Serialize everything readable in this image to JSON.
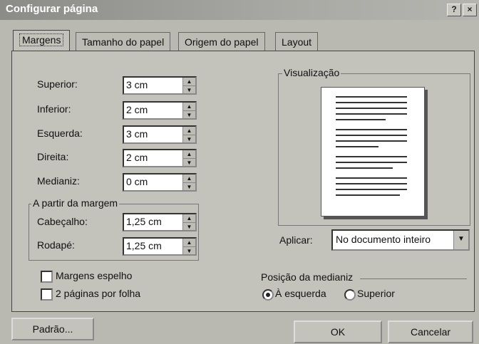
{
  "window": {
    "title": "Configurar página",
    "help_btn": "?",
    "close_btn": "×"
  },
  "tabs": [
    {
      "label": "Margens",
      "active": true
    },
    {
      "label": "Tamanho do papel",
      "active": false
    },
    {
      "label": "Origem do papel",
      "active": false
    },
    {
      "label": "Layout",
      "active": false
    }
  ],
  "margins": {
    "top_label": "Superior:",
    "top_value": "3 cm",
    "bottom_label": "Inferior:",
    "bottom_value": "2 cm",
    "left_label": "Esquerda:",
    "left_value": "3 cm",
    "right_label": "Direita:",
    "right_value": "2 cm",
    "gutter_label": "Medianiz:",
    "gutter_value": "0 cm"
  },
  "from_margin": {
    "group_label": "A partir da margem",
    "header_label": "Cabeçalho:",
    "header_value": "1,25 cm",
    "footer_label": "Rodapé:",
    "footer_value": "1,25 cm"
  },
  "checkboxes": {
    "mirror_label": "Margens espelho",
    "two_pages_label": "2 páginas por folha"
  },
  "preview": {
    "group_label": "Visualização"
  },
  "apply": {
    "label": "Aplicar:",
    "value": "No documento inteiro"
  },
  "gutter_position": {
    "group_label": "Posição da medianiz",
    "left_label": "À esquerda",
    "top_label": "Superior"
  },
  "buttons": {
    "default": "Padrão...",
    "ok": "OK",
    "cancel": "Cancelar"
  },
  "icons": {
    "spin_up": "up-arrow-icon",
    "spin_down": "down-arrow-icon",
    "dropdown": "chevron-down-icon"
  }
}
